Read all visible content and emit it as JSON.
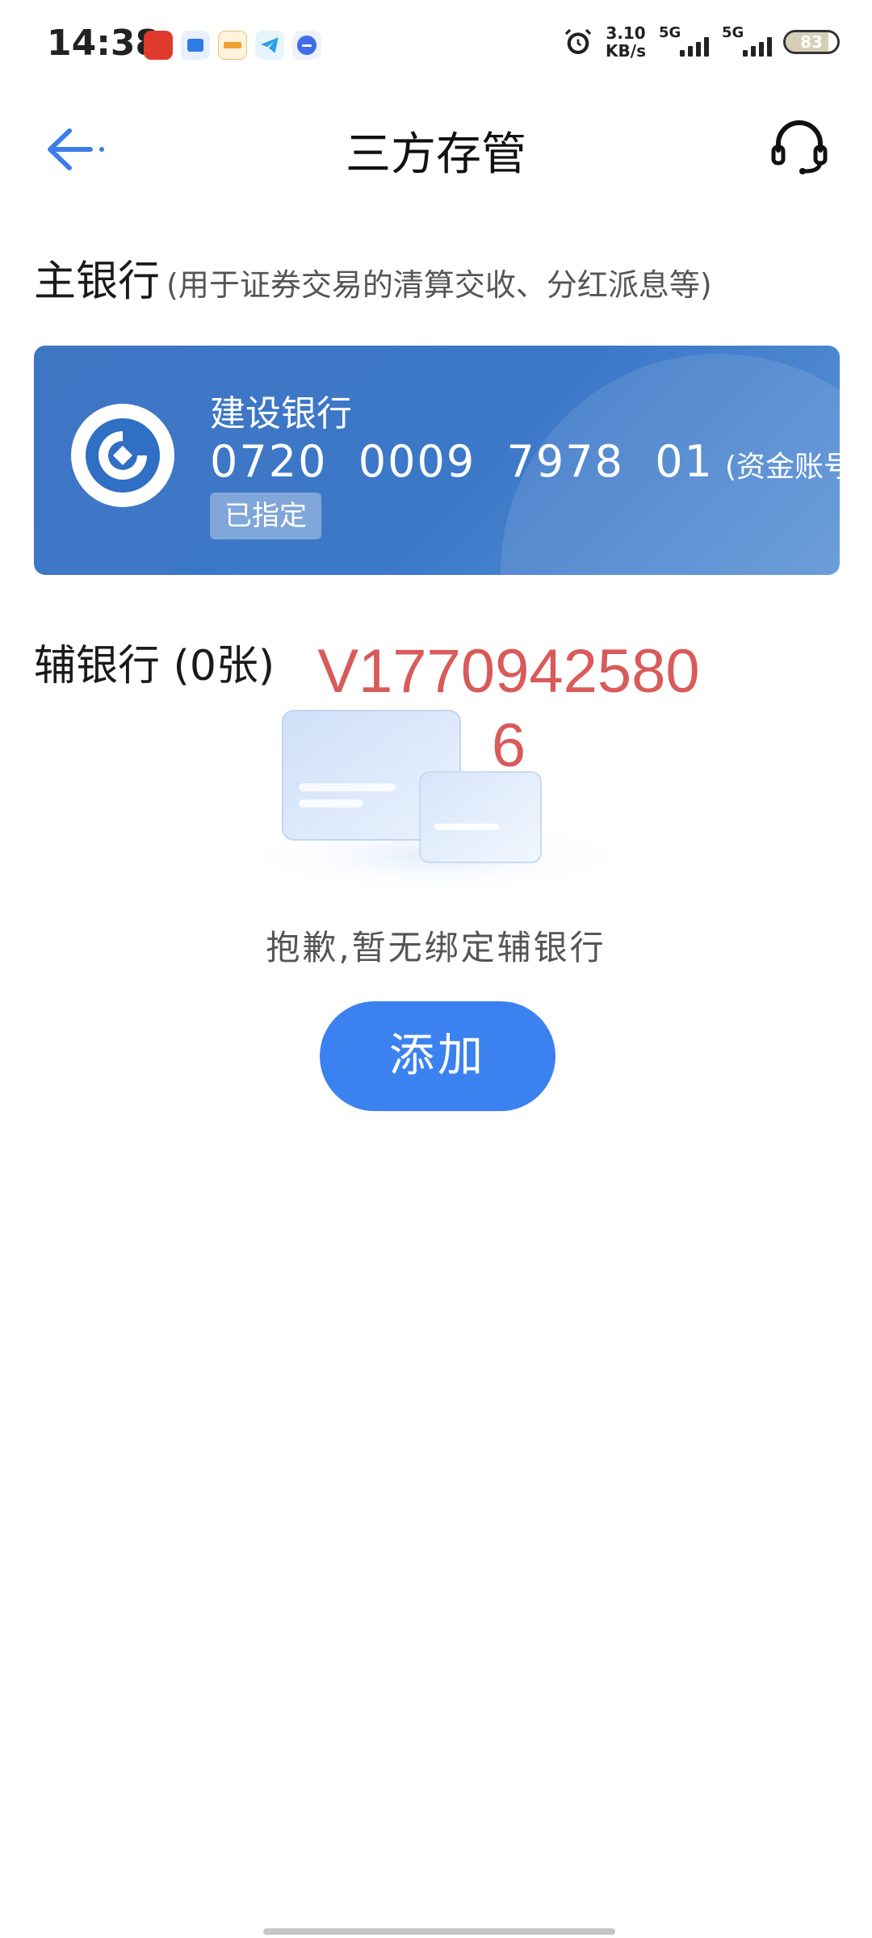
{
  "status_bar": {
    "time": "14:38",
    "speed_value": "3.10",
    "speed_unit": "KB/s",
    "sim1_label": "5G",
    "sim2_label": "5G",
    "battery_level": 83,
    "battery_text": "83",
    "app_icons": [
      "app-icon-red",
      "app-icon-blue",
      "app-icon-orange",
      "telegram-icon",
      "message-icon"
    ]
  },
  "nav": {
    "title": "三方存管"
  },
  "main_bank": {
    "section_title": "主银行",
    "section_subtitle": "(用于证券交易的清算交收、分红派息等)",
    "bank_name": "建设银行",
    "account_number": "0720  0009  7978  01",
    "account_note": "(资金账号)",
    "status_badge": "已指定",
    "logo_icon": "ccb-bank-logo"
  },
  "secondary_bank": {
    "section_title": "辅银行 (0张)",
    "watermark_line1": "V1770942580",
    "watermark_line2": "6",
    "empty_message": "抱歉,暂无绑定辅银行",
    "add_button": "添加"
  },
  "colors": {
    "accent": "#3b82f0",
    "card_blue": "#3c78c8",
    "watermark_red": "#d95a5a"
  }
}
